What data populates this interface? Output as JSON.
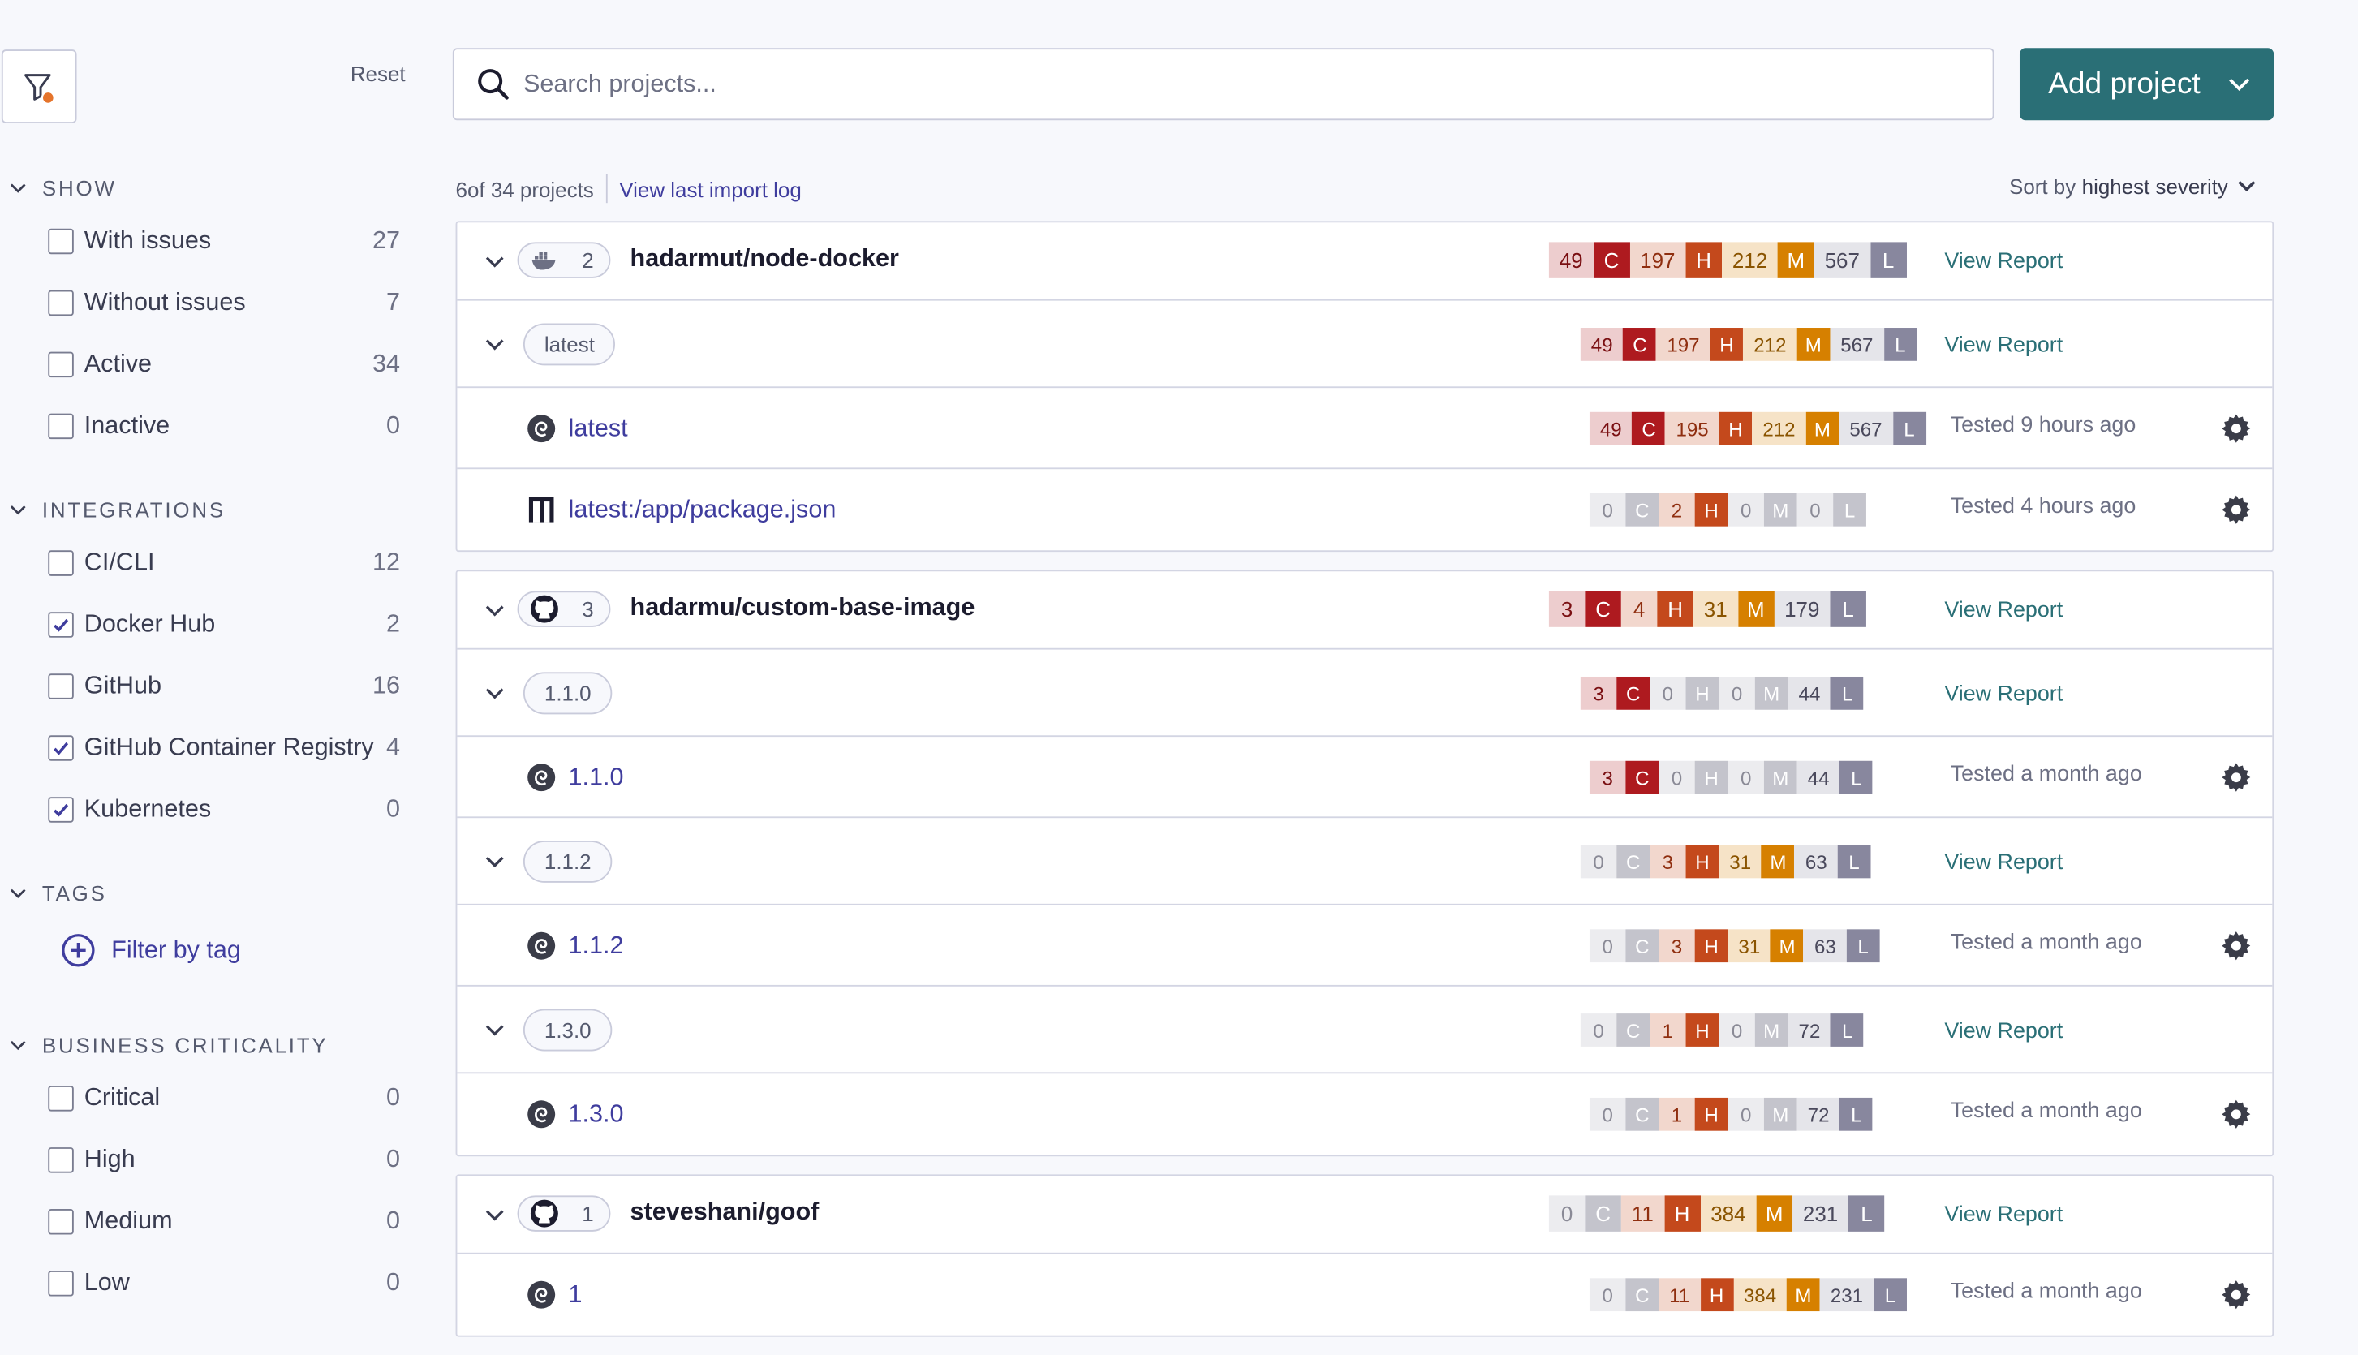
{
  "sidebar": {
    "reset_label": "Reset",
    "show": {
      "title": "Show",
      "items": [
        {
          "label": "With issues",
          "count": "27",
          "checked": false
        },
        {
          "label": "Without issues",
          "count": "7",
          "checked": false
        },
        {
          "label": "Active",
          "count": "34",
          "checked": false
        },
        {
          "label": "Inactive",
          "count": "0",
          "checked": false
        }
      ]
    },
    "integrations": {
      "title": "Integrations",
      "items": [
        {
          "label": "CI/CLI",
          "count": "12",
          "checked": false
        },
        {
          "label": "Docker Hub",
          "count": "2",
          "checked": true
        },
        {
          "label": "GitHub",
          "count": "16",
          "checked": false
        },
        {
          "label": "GitHub Container Registry",
          "count": "4",
          "checked": true
        },
        {
          "label": "Kubernetes",
          "count": "0",
          "checked": true
        }
      ]
    },
    "tags": {
      "title": "Tags",
      "filter_label": "Filter by tag"
    },
    "criticality": {
      "title": "Business Criticality",
      "items": [
        {
          "label": "Critical",
          "count": "0",
          "checked": false
        },
        {
          "label": "High",
          "count": "0",
          "checked": false
        },
        {
          "label": "Medium",
          "count": "0",
          "checked": false
        },
        {
          "label": "Low",
          "count": "0",
          "checked": false
        }
      ]
    }
  },
  "search": {
    "placeholder": "Search projects..."
  },
  "add_project_label": "Add project",
  "meta": {
    "count_strong": "6",
    "count_rest": " of 34 projects",
    "import_log": "View last import log"
  },
  "sort": {
    "prefix": "Sort by",
    "value": "highest severity"
  },
  "labels": {
    "view_report": "View Report",
    "sev": [
      "C",
      "H",
      "M",
      "L"
    ]
  },
  "colors": {
    "accent": "#2a6f76",
    "link": "#3f3d9e",
    "critical": "#ae1a1f",
    "high": "#c4491c",
    "medium": "#d68000",
    "low": "#88879e"
  },
  "groups": [
    {
      "name": "hadarmut/node-docker",
      "integration_icon": "docker-icon",
      "target_count": "2",
      "counts": [
        "49",
        "197",
        "212",
        "567"
      ],
      "tags": [
        {
          "tag": "latest",
          "counts": [
            "49",
            "197",
            "212",
            "567"
          ],
          "targets": [
            {
              "name": "latest",
              "icon": "debian-icon",
              "counts": [
                "49",
                "195",
                "212",
                "567"
              ],
              "tested": "Tested 9 hours ago"
            },
            {
              "name": "latest:/app/package.json",
              "icon": "npm-icon",
              "counts": [
                "0",
                "2",
                "0",
                "0"
              ],
              "tested": "Tested 4 hours ago"
            }
          ]
        }
      ]
    },
    {
      "name": "hadarmu/custom-base-image",
      "integration_icon": "github-icon",
      "target_count": "3",
      "counts": [
        "3",
        "4",
        "31",
        "179"
      ],
      "tags": [
        {
          "tag": "1.1.0",
          "counts": [
            "3",
            "0",
            "0",
            "44"
          ],
          "targets": [
            {
              "name": "1.1.0",
              "icon": "debian-icon",
              "counts": [
                "3",
                "0",
                "0",
                "44"
              ],
              "tested": "Tested a month ago"
            }
          ]
        },
        {
          "tag": "1.1.2",
          "counts": [
            "0",
            "3",
            "31",
            "63"
          ],
          "targets": [
            {
              "name": "1.1.2",
              "icon": "debian-icon",
              "counts": [
                "0",
                "3",
                "31",
                "63"
              ],
              "tested": "Tested a month ago"
            }
          ]
        },
        {
          "tag": "1.3.0",
          "counts": [
            "0",
            "1",
            "0",
            "72"
          ],
          "targets": [
            {
              "name": "1.3.0",
              "icon": "debian-icon",
              "counts": [
                "0",
                "1",
                "0",
                "72"
              ],
              "tested": "Tested a month ago"
            }
          ]
        }
      ]
    },
    {
      "name": "steveshani/goof",
      "integration_icon": "github-icon",
      "target_count": "1",
      "counts": [
        "0",
        "11",
        "384",
        "231"
      ],
      "tags": [],
      "targets": [
        {
          "name": "1",
          "icon": "debian-icon",
          "counts": [
            "0",
            "11",
            "384",
            "231"
          ],
          "tested": "Tested a month ago"
        }
      ]
    }
  ]
}
